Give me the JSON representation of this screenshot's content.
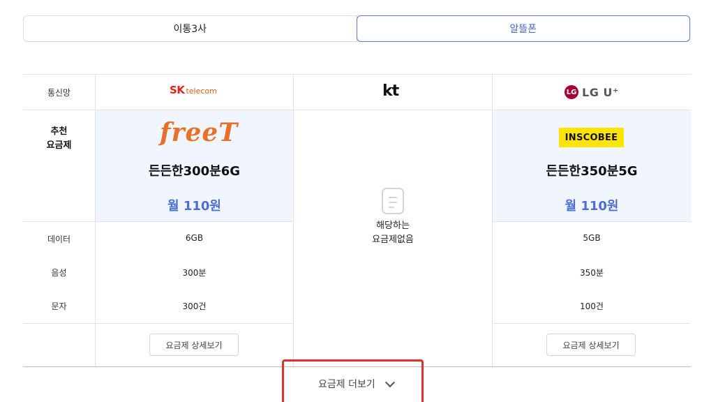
{
  "tabs": [
    {
      "label": "이통3사",
      "active": false
    },
    {
      "label": "알뜰폰",
      "active": true
    }
  ],
  "row_labels": {
    "carrier": "통신망",
    "recommended": [
      "추천",
      "요금제"
    ],
    "data": "데이터",
    "voice": "음성",
    "sms": "문자"
  },
  "columns": [
    {
      "carrier_logo": {
        "mark": "SK",
        "text": "telecom"
      },
      "brand_logo": "freeT",
      "plan_name": "든든한300분6G",
      "price": "월 110원",
      "data": "6GB",
      "voice": "300분",
      "sms": "300건",
      "detail_button": "요금제 상세보기"
    },
    {
      "carrier_logo": {
        "text": "kt"
      },
      "empty_message": [
        "해당하는",
        "요금제없음"
      ]
    },
    {
      "carrier_logo": {
        "mark": "LG",
        "text": "LG U⁺"
      },
      "brand_logo": "INSCOBEE",
      "plan_name": "든든한350분5G",
      "price": "월 110원",
      "data": "5GB",
      "voice": "350분",
      "sms": "100건",
      "detail_button": "요금제 상세보기"
    }
  ],
  "more_button": "요금제 더보기",
  "colors": {
    "accent": "#4b6ed4",
    "recommend_bg": "#f1f5fd",
    "sk_red": "#e2231a",
    "freet_orange": "#e8702a",
    "lg_red": "#a50034",
    "insco_yellow": "#ffe400",
    "highlight_box": "#e0322c"
  }
}
